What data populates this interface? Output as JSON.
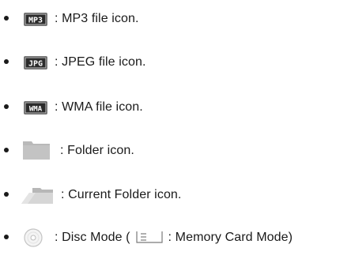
{
  "legend": {
    "items": [
      {
        "icon": "mp3-file-icon",
        "badge_text": "MP3",
        "description": ": MP3 file icon."
      },
      {
        "icon": "jpeg-file-icon",
        "badge_text": "JPG",
        "description": ": JPEG file icon."
      },
      {
        "icon": "wma-file-icon",
        "badge_text": "WMA",
        "description": ": WMA file icon."
      },
      {
        "icon": "folder-icon",
        "description": ": Folder icon."
      },
      {
        "icon": "current-folder-icon",
        "description": ": Current Folder icon."
      },
      {
        "icon": "disc-mode-icon",
        "description_before": ": Disc Mode (",
        "secondary_icon": "memory-card-mode-icon",
        "description_after": ": Memory Card Mode)"
      }
    ]
  },
  "colors": {
    "text": "#1a1a1a",
    "badge_dark": "#2b2b2b",
    "folder_gray": "#b9b9b9",
    "folder_light": "#dedede",
    "disc_ring": "#c4c4c4"
  }
}
